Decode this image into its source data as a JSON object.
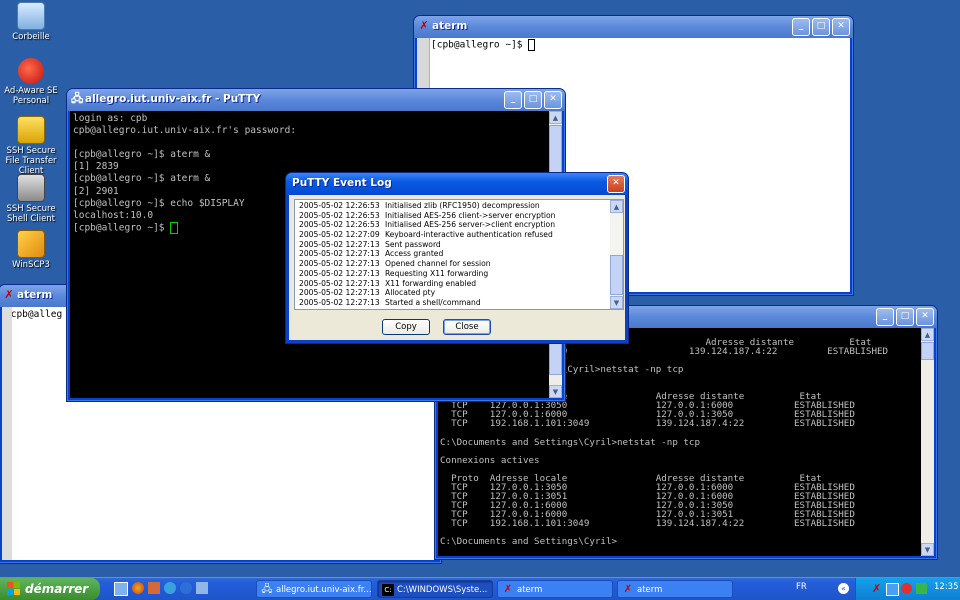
{
  "desktop": {
    "icons": [
      {
        "label": "Corbeille",
        "icon": "recycle-bin-icon"
      },
      {
        "label": "Ad-Aware SE Personal",
        "icon": "ad-aware-icon"
      },
      {
        "label": "SSH Secure File Transfer Client",
        "icon": "ssh-file-transfer-icon"
      },
      {
        "label": "SSH Secure Shell Client",
        "icon": "ssh-shell-icon"
      },
      {
        "label": "WinSCP3",
        "icon": "winscp-icon"
      }
    ]
  },
  "aterm_top": {
    "title": "aterm",
    "prompt": "[cpb@allegro ~]$ "
  },
  "aterm_left": {
    "title": "aterm",
    "prompt": "[cpb@alleg"
  },
  "putty": {
    "title": "allegro.iut.univ-aix.fr - PuTTY",
    "lines": [
      "login as: cpb",
      "cpb@allegro.iut.univ-aix.fr's password:",
      "",
      "[cpb@allegro ~]$ aterm &",
      "[1] 2839",
      "[cpb@allegro ~]$ aterm &",
      "[2] 2901",
      "[cpb@allegro ~]$ echo $DISPLAY",
      "localhost:10.0"
    ],
    "last_prompt": "[cpb@allegro ~]$ "
  },
  "event_log": {
    "title": "PuTTY Event Log",
    "entries": [
      {
        "time": "2005-05-02 12:26:53",
        "msg": "Initialised zlib (RFC1950) decompression"
      },
      {
        "time": "2005-05-02 12:26:53",
        "msg": "Initialised AES-256 client->server encryption"
      },
      {
        "time": "2005-05-02 12:26:53",
        "msg": "Initialised AES-256 server->client encryption"
      },
      {
        "time": "2005-05-02 12:27:09",
        "msg": "Keyboard-interactive authentication refused"
      },
      {
        "time": "2005-05-02 12:27:13",
        "msg": "Sent password"
      },
      {
        "time": "2005-05-02 12:27:13",
        "msg": "Access granted"
      },
      {
        "time": "2005-05-02 12:27:13",
        "msg": "Opened channel for session"
      },
      {
        "time": "2005-05-02 12:27:13",
        "msg": "Requesting X11 forwarding"
      },
      {
        "time": "2005-05-02 12:27:13",
        "msg": "X11 forwarding enabled"
      },
      {
        "time": "2005-05-02 12:27:13",
        "msg": "Allocated pty"
      },
      {
        "time": "2005-05-02 12:27:13",
        "msg": "Started a shell/command"
      }
    ],
    "copy_label": "Copy",
    "close_label": "Close"
  },
  "console": {
    "lines": [
      "                                                Adresse distante          Etat",
      "                :1:3049                      139.124.187.4:22         ESTABLISHED",
      "",
      "                  ings\\Cyril>netstat -np tcp",
      "",
      "",
      "  Proto  Adresse locale                Adresse distante          Etat",
      "  TCP    127.0.0.1:3050                127.0.0.1:6000           ESTABLISHED",
      "  TCP    127.0.0.1:6000                127.0.0.1:3050           ESTABLISHED",
      "  TCP    192.168.1.101:3049            139.124.187.4:22         ESTABLISHED",
      "",
      "C:\\Documents and Settings\\Cyril>netstat -np tcp",
      "",
      "Connexions actives",
      "",
      "  Proto  Adresse locale                Adresse distante          Etat",
      "  TCP    127.0.0.1:3050                127.0.0.1:6000           ESTABLISHED",
      "  TCP    127.0.0.1:3051                127.0.0.1:6000           ESTABLISHED",
      "  TCP    127.0.0.1:6000                127.0.0.1:3050           ESTABLISHED",
      "  TCP    127.0.0.1:6000                127.0.0.1:3051           ESTABLISHED",
      "  TCP    192.168.1.101:3049            139.124.187.4:22         ESTABLISHED",
      "",
      "C:\\Documents and Settings\\Cyril>"
    ]
  },
  "taskbar": {
    "start_label": "démarrer",
    "tasks": [
      {
        "label": "allegro.iut.univ-aix.fr...",
        "icon": "putty-icon"
      },
      {
        "label": "C:\\WINDOWS\\Syste...",
        "icon": "cmd-icon"
      },
      {
        "label": "aterm",
        "icon": "x-icon"
      },
      {
        "label": "aterm",
        "icon": "x-icon"
      }
    ],
    "language": "FR",
    "clock": "12:35"
  }
}
